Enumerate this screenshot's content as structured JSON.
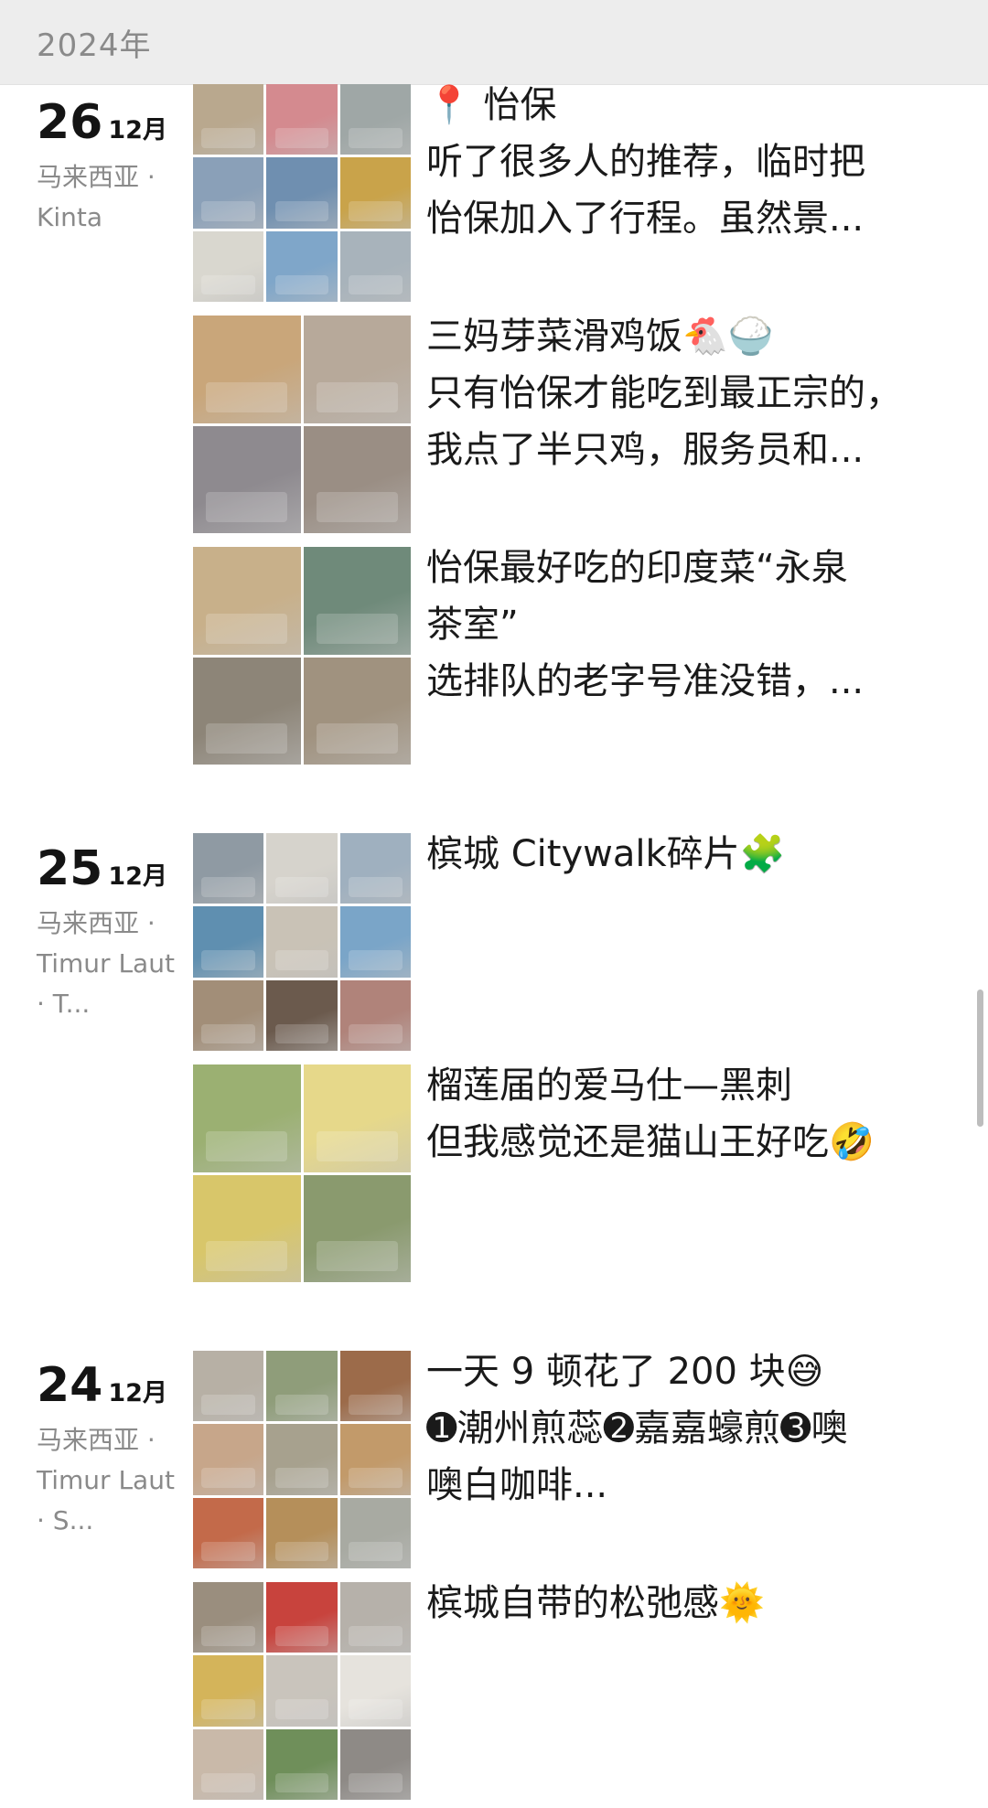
{
  "header": {
    "year": "2024年"
  },
  "groups": [
    {
      "day": "26",
      "month": "12月",
      "location": "马来西亚 · Kinta",
      "posts": [
        {
          "lines": [
            "📍 怡保",
            "听了很多人的推荐，临时把",
            "怡保加入了行程。虽然景..."
          ],
          "photo_colors": [
            "#b9a88e",
            "#d48a8f",
            "#9fa7a6",
            "#8aa0b8",
            "#6f8fb0",
            "#c9a34a",
            "#d9d7cf",
            "#7fa6c9",
            "#a8b3bb"
          ]
        },
        {
          "lines": [
            "三妈芽菜滑鸡饭🐔🍚",
            "只有怡保才能吃到最正宗的，",
            "我点了半只鸡，服务员和..."
          ],
          "photo_colors": [
            "#c9a67a",
            "#b7a99a",
            "#8e8a8f",
            "#9a8e84"
          ]
        },
        {
          "lines": [
            "怡保最好吃的印度菜“永泉",
            "茶室”",
            "选排队的老字号准没错，..."
          ],
          "photo_colors": [
            "#c8b08a",
            "#6f8a7a",
            "#8d8578",
            "#a0927f"
          ]
        }
      ]
    },
    {
      "day": "25",
      "month": "12月",
      "location": "马来西亚 · Timur Laut · T...",
      "posts": [
        {
          "lines": [
            "槟城 Citywalk碎片🧩"
          ],
          "photo_colors": [
            "#8f9aa3",
            "#d6d3cc",
            "#9fb0bf",
            "#5f8fb0",
            "#c9c2b6",
            "#7aa5c8",
            "#a28e78",
            "#6b5a4d",
            "#b0837a"
          ]
        },
        {
          "lines": [
            "榴莲届的爱马仕—黑刺",
            "但我感觉还是猫山王好吃🤣"
          ],
          "photo_colors": [
            "#9bb072",
            "#e6d88a",
            "#d8c66a",
            "#8a9a6e"
          ]
        }
      ]
    },
    {
      "day": "24",
      "month": "12月",
      "location": "马来西亚 · Timur Laut · S...",
      "posts": [
        {
          "lines": [
            "一天 9 顿花了 200 块😅",
            "➊潮州煎蕊➋嘉嘉蠔煎➌噢",
            "噢白咖啡..."
          ],
          "photo_colors": [
            "#b7b0a5",
            "#8f9d7a",
            "#9c6b4a",
            "#c7a68a",
            "#a7a18e",
            "#c29a6a",
            "#c36a4a",
            "#b58f5a",
            "#a8aaa2"
          ]
        },
        {
          "lines": [
            "槟城自带的松弛感🌞"
          ],
          "photo_colors": [
            "#9a8e7e",
            "#c8433d",
            "#b6b1aa",
            "#d4b45a",
            "#c9c4bc",
            "#e6e3dd",
            "#c9b9a9",
            "#6f8f5a",
            "#8e8a86"
          ]
        }
      ]
    }
  ]
}
